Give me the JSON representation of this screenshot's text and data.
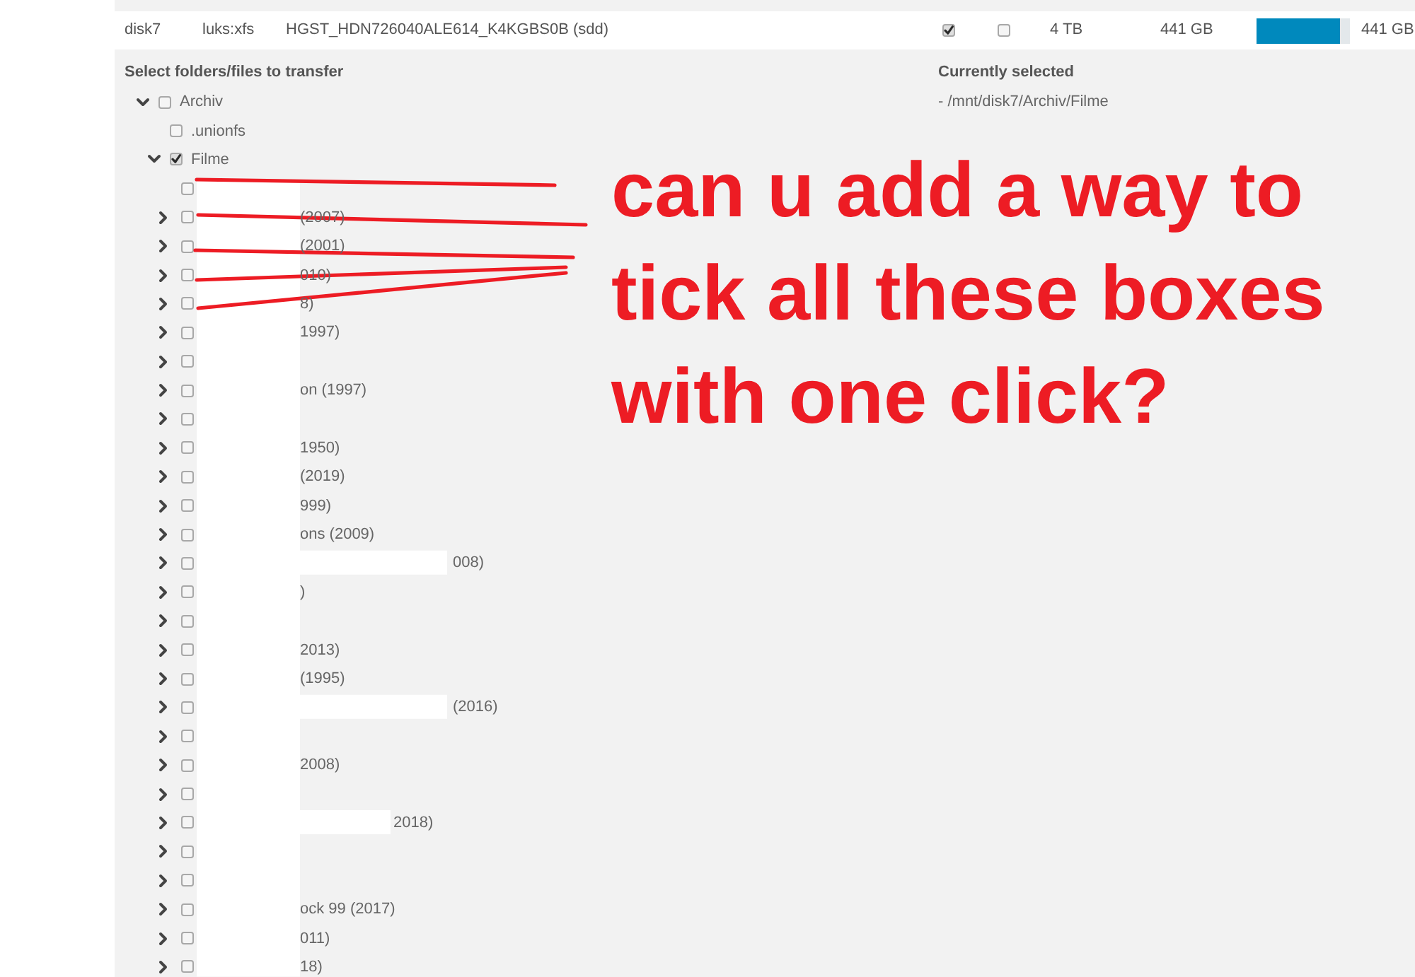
{
  "disk_row": {
    "cells": [
      {
        "kind": "text",
        "text": "disk7"
      },
      {
        "kind": "text",
        "text": "luks:xfs"
      },
      {
        "kind": "text",
        "text": "HGST_HDN726040ALE614_K4KGBS0B (sdd)"
      },
      {
        "kind": "checkbox",
        "checked": true
      },
      {
        "kind": "checkbox",
        "checked": false
      },
      {
        "kind": "text",
        "text": "4 TB"
      },
      {
        "kind": "text",
        "text": "441 GB"
      },
      {
        "kind": "bar",
        "level": 0.89
      },
      {
        "kind": "text",
        "text": "441 GB"
      }
    ]
  },
  "tree": {
    "title": "Select folders/files to transfer",
    "items": [
      {
        "label": "Archiv",
        "expandable": true,
        "expanded": true,
        "checked": false,
        "children": [
          {
            "label": ".unionfs",
            "expandable": false,
            "checked": false
          },
          {
            "label": "Filme",
            "expandable": true,
            "expanded": true,
            "checked": true,
            "children": [
              {
                "kind": "narrow",
                "expandable": false,
                "checked": false
              },
              {
                "kind": "narrow",
                "label": "(2007)",
                "expandable": true,
                "expanded": false,
                "checked": false
              },
              {
                "kind": "narrow",
                "label": "(2001)",
                "expandable": true,
                "expanded": false,
                "checked": false
              },
              {
                "kind": "narrow",
                "label": "010)",
                "expandable": true,
                "expanded": false,
                "checked": false
              },
              {
                "kind": "narrow",
                "label": "8)",
                "expandable": true,
                "expanded": false,
                "checked": false
              },
              {
                "kind": "narrow",
                "label": "1997)",
                "expandable": true,
                "expanded": false,
                "checked": false
              },
              {
                "kind": "narrow",
                "expandable": true,
                "expanded": false,
                "checked": false
              },
              {
                "kind": "narrow",
                "label": "on (1997)",
                "expandable": true,
                "expanded": false,
                "checked": false
              },
              {
                "kind": "narrow",
                "expandable": true,
                "expanded": false,
                "checked": false
              },
              {
                "kind": "narrow",
                "label": "1950)",
                "expandable": true,
                "expanded": false,
                "checked": false
              },
              {
                "kind": "narrow",
                "label": "(2019)",
                "expandable": true,
                "expanded": false,
                "checked": false
              },
              {
                "kind": "narrow",
                "label": "999)",
                "expandable": true,
                "expanded": false,
                "checked": false
              },
              {
                "kind": "narrow",
                "label": "ons (2009)",
                "expandable": true,
                "expanded": false,
                "checked": false
              },
              {
                "kind": "wide",
                "label": "008)",
                "expandable": true,
                "expanded": false,
                "checked": false
              },
              {
                "kind": "narrow",
                "label": ")",
                "expandable": true,
                "expanded": false,
                "checked": false
              },
              {
                "kind": "narrow",
                "expandable": true,
                "expanded": false,
                "checked": false
              },
              {
                "kind": "narrow",
                "label": "2013)",
                "expandable": true,
                "expanded": false,
                "checked": false
              },
              {
                "kind": "narrow",
                "label": "(1995)",
                "expandable": true,
                "expanded": false,
                "checked": false
              },
              {
                "kind": "wide",
                "label": "(2016)",
                "expandable": true,
                "expanded": false,
                "checked": false
              },
              {
                "kind": "narrow",
                "expandable": true,
                "expanded": false,
                "checked": false
              },
              {
                "kind": "narrow",
                "label": "2008)",
                "expandable": true,
                "expanded": false,
                "checked": false
              },
              {
                "kind": "narrow",
                "expandable": true,
                "expanded": false,
                "checked": false
              },
              {
                "kind": "medium",
                "label": "2018)",
                "expandable": true,
                "expanded": false,
                "checked": false
              },
              {
                "kind": "narrow",
                "expandable": true,
                "expanded": false,
                "checked": false
              },
              {
                "kind": "narrow",
                "expandable": true,
                "expanded": false,
                "checked": false
              },
              {
                "kind": "narrow",
                "label": "ock 99 (2017)",
                "expandable": true,
                "expanded": false,
                "checked": false
              },
              {
                "kind": "narrow",
                "label": "011)",
                "expandable": true,
                "expanded": false,
                "checked": false
              },
              {
                "kind": "narrow",
                "label": "18)",
                "expandable": true,
                "expanded": false,
                "checked": false
              }
            ]
          }
        ]
      }
    ]
  },
  "selection": {
    "title": "Currently selected",
    "items": [
      "- /mnt/disk7/Archiv/Filme"
    ]
  },
  "annotation": {
    "lines": [
      "can u add a way to",
      "tick all these boxes",
      "with one click?"
    ]
  }
}
